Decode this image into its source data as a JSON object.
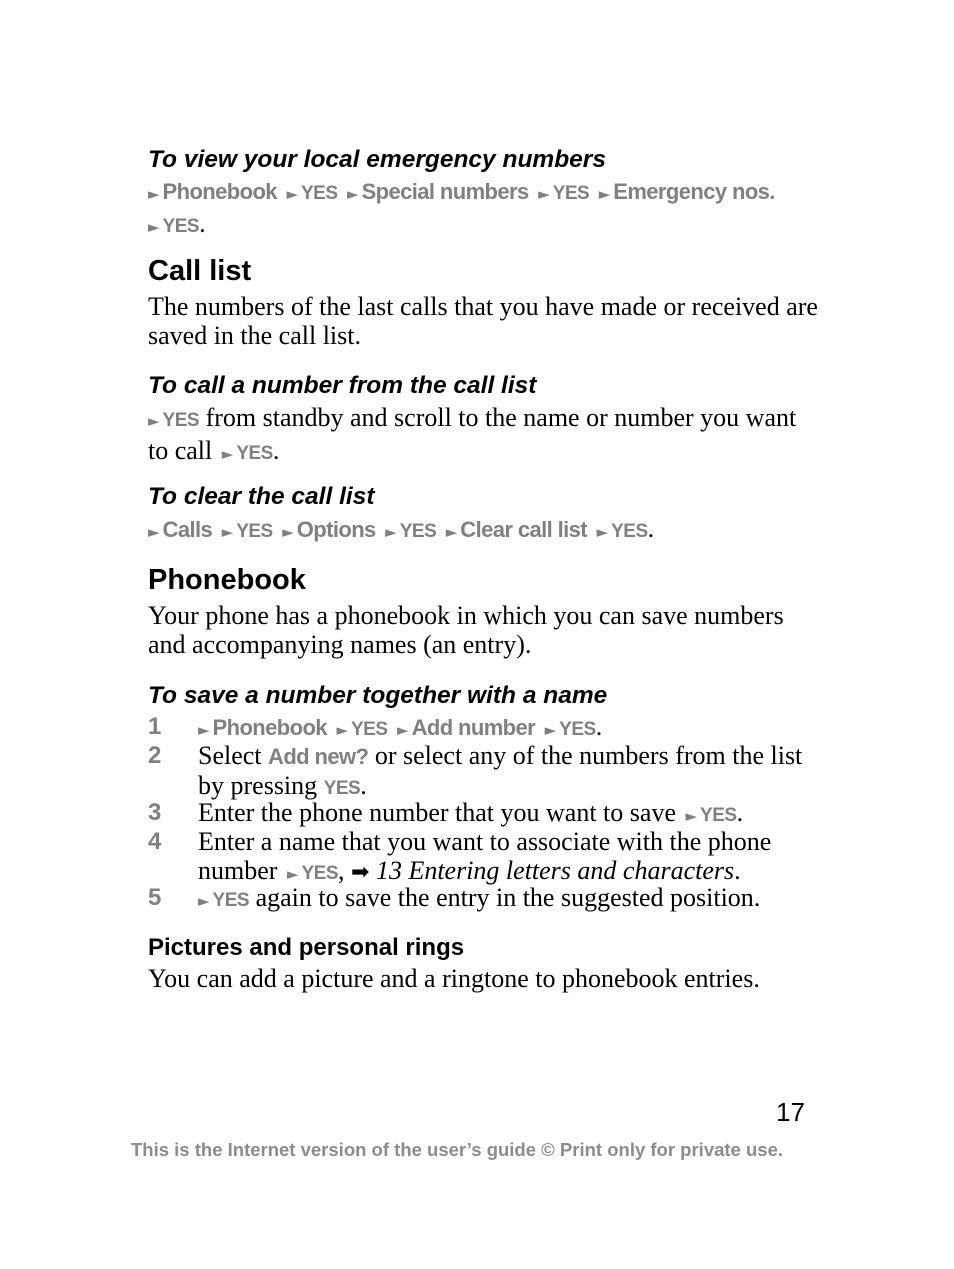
{
  "sections": {
    "emergency": {
      "heading": "To view your local emergency numbers",
      "path": [
        "Phonebook",
        "YES",
        "Special numbers",
        "YES",
        "Emergency nos.",
        "YES"
      ]
    },
    "call_list": {
      "title": "Call list",
      "intro": "The numbers of the last calls that you have made or received are saved in the call list.",
      "call_from_list": {
        "heading": "To call a number from the call list",
        "yes1": "YES",
        "text1": " from standby and scroll to the name or number you want to call ",
        "yes2": "YES"
      },
      "clear_list": {
        "heading": "To clear the call list",
        "path": [
          "Calls",
          "YES",
          "Options",
          "YES",
          "Clear call list",
          "YES"
        ]
      }
    },
    "phonebook": {
      "title": "Phonebook",
      "intro": "Your phone has a phonebook in which you can save numbers and accompanying names (an entry).",
      "save_number": {
        "heading": "To save a number together with a name",
        "steps": [
          {
            "num": "1",
            "path": [
              "Phonebook",
              "YES",
              "Add number",
              "YES"
            ]
          },
          {
            "num": "2",
            "pre": "Select ",
            "menu": "Add new?",
            "mid": " or select any of the numbers from the list by pressing ",
            "yes": "YES"
          },
          {
            "num": "3",
            "text": "Enter the phone number that you want to save ",
            "yes": "YES"
          },
          {
            "num": "4",
            "text": "Enter a name that you want to associate with the phone number ",
            "yes": "YES",
            "xref_icon": "right-arrow-icon",
            "xref": "13 Entering letters and characters"
          },
          {
            "num": "5",
            "yes": "YES",
            "text": " again to save the entry in the suggested position."
          }
        ]
      },
      "pictures": {
        "heading": "Pictures and personal rings",
        "text": "You can add a picture and a ringtone to phonebook entries."
      }
    }
  },
  "page_number": "17",
  "footer": "This is the Internet version of the user’s guide © Print only for private use.",
  "glyphs": {
    "arrow": "►",
    "xref": "➡"
  }
}
